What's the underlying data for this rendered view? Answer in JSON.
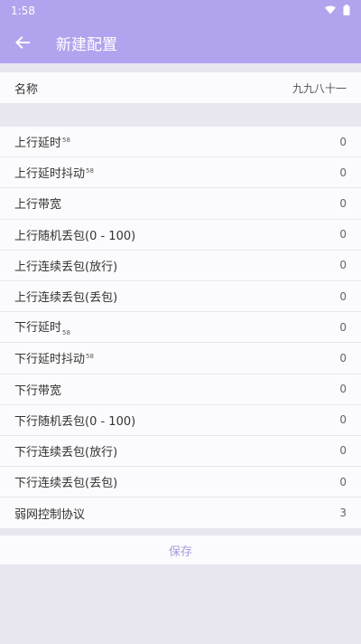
{
  "status_bar": {
    "time": "1:58",
    "wifi_icon": "wifi-icon",
    "battery_icon": "battery-icon"
  },
  "app_bar": {
    "title": "新建配置",
    "back_icon": "arrow-left-icon"
  },
  "name_field": {
    "label": "名称",
    "value": "九九八十一"
  },
  "settings": [
    {
      "label": "上行延时",
      "marker": "58",
      "marker_pos": "sup",
      "value": "0"
    },
    {
      "label": "上行延时抖动",
      "marker": "58",
      "marker_pos": "sup",
      "value": "0"
    },
    {
      "label": "上行带宽",
      "marker": "",
      "marker_pos": "",
      "value": "0"
    },
    {
      "label": "上行随机丢包(0 - 100)",
      "marker": "",
      "marker_pos": "",
      "value": "0"
    },
    {
      "label": "上行连续丢包(放行)",
      "marker": "",
      "marker_pos": "",
      "value": "0"
    },
    {
      "label": "上行连续丢包(丢包)",
      "marker": "",
      "marker_pos": "",
      "value": "0"
    },
    {
      "label": "下行延时",
      "marker": "58",
      "marker_pos": "sub",
      "value": "0"
    },
    {
      "label": "下行延时抖动",
      "marker": "58",
      "marker_pos": "sup",
      "value": "0"
    },
    {
      "label": "下行带宽",
      "marker": "",
      "marker_pos": "",
      "value": "0"
    },
    {
      "label": "下行随机丢包(0 - 100)",
      "marker": "",
      "marker_pos": "",
      "value": "0"
    },
    {
      "label": "下行连续丢包(放行)",
      "marker": "",
      "marker_pos": "",
      "value": "0"
    },
    {
      "label": "下行连续丢包(丢包)",
      "marker": "",
      "marker_pos": "",
      "value": "0"
    },
    {
      "label": "弱网控制协议",
      "marker": "",
      "marker_pos": "",
      "value": "3"
    }
  ],
  "footer": {
    "save_label": "保存"
  },
  "colors": {
    "accent": "#b3a3ee",
    "save_text": "#a79be0",
    "background": "#e8e6ee"
  }
}
